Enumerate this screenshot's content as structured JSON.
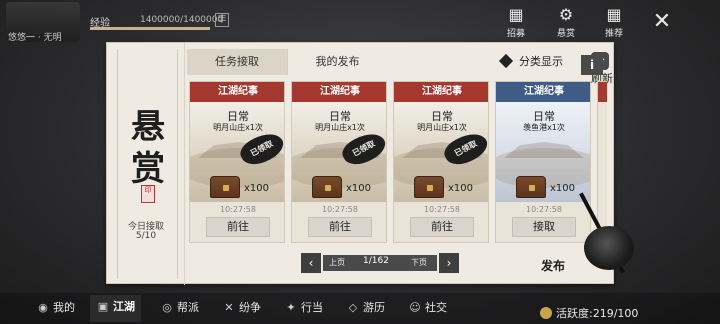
{
  "hud": {
    "player_name": "悠悠一 · 无明",
    "exp_label": "经验",
    "exp_value": "1400000/1400000",
    "exp_fraction": 1.0,
    "exp_button": "丰",
    "icons": [
      {
        "icon": "scroll-icon",
        "glyph": "▦",
        "label": "招募"
      },
      {
        "icon": "gear-icon",
        "glyph": "⚙",
        "label": "悬赏"
      },
      {
        "icon": "grid-icon",
        "glyph": "▦",
        "label": "推荐"
      }
    ],
    "close_glyph": "✕"
  },
  "panel": {
    "title_chars": [
      "悬",
      "赏"
    ],
    "seal_text": "印",
    "today_label": "今日接取",
    "today_value": "5/10",
    "tabs": [
      {
        "label": "任务接取",
        "active": true
      },
      {
        "label": "我的发布",
        "active": false
      }
    ],
    "filter_label": "分类显示",
    "refresh_label": "刷新",
    "info_label": "i",
    "cards": [
      {
        "header": "江湖纪事",
        "type": "日常",
        "place": "明月山庄x1次",
        "stamp": "已领取",
        "count": "x100",
        "time": "10:27:58",
        "button": "前往",
        "theme": "red"
      },
      {
        "header": "江湖纪事",
        "type": "日常",
        "place": "明月山庄x1次",
        "stamp": "已领取",
        "count": "x100",
        "time": "10:27:58",
        "button": "前往",
        "theme": "red"
      },
      {
        "header": "江湖纪事",
        "type": "日常",
        "place": "明月山庄x1次",
        "stamp": "已领取",
        "count": "x100",
        "time": "10:27:58",
        "button": "前往",
        "theme": "red"
      },
      {
        "header": "江湖纪事",
        "type": "日常",
        "place": "羡鱼港x1次",
        "stamp": "",
        "count": "x100",
        "time": "10:27:58",
        "button": "接取",
        "theme": "blue"
      }
    ],
    "pager": {
      "prev": "上页",
      "count": "1/162",
      "next": "下页",
      "left_arrow": "‹",
      "right_arrow": "›"
    },
    "publish_label": "发布"
  },
  "bottom_nav": {
    "items": [
      {
        "icon": "user-icon",
        "glyph": "◉",
        "label": "我的",
        "active": false
      },
      {
        "icon": "jianghu-icon",
        "glyph": "▣",
        "label": "江湖",
        "active": true
      },
      {
        "icon": "guild-icon",
        "glyph": "◎",
        "label": "帮派",
        "active": false
      },
      {
        "icon": "swords-icon",
        "glyph": "✕",
        "label": "纷争",
        "active": false
      },
      {
        "icon": "walk-icon",
        "glyph": "✦",
        "label": "行当",
        "active": false
      },
      {
        "icon": "compass-icon",
        "glyph": "◇",
        "label": "游历",
        "active": false
      },
      {
        "icon": "social-icon",
        "glyph": "☺",
        "label": "社交",
        "active": false
      }
    ],
    "activity": "活跃度:219/100"
  },
  "colors": {
    "card_header_red": "#a6392f",
    "card_header_blue": "#3e5c86",
    "panel_bg": "#efebe3"
  }
}
